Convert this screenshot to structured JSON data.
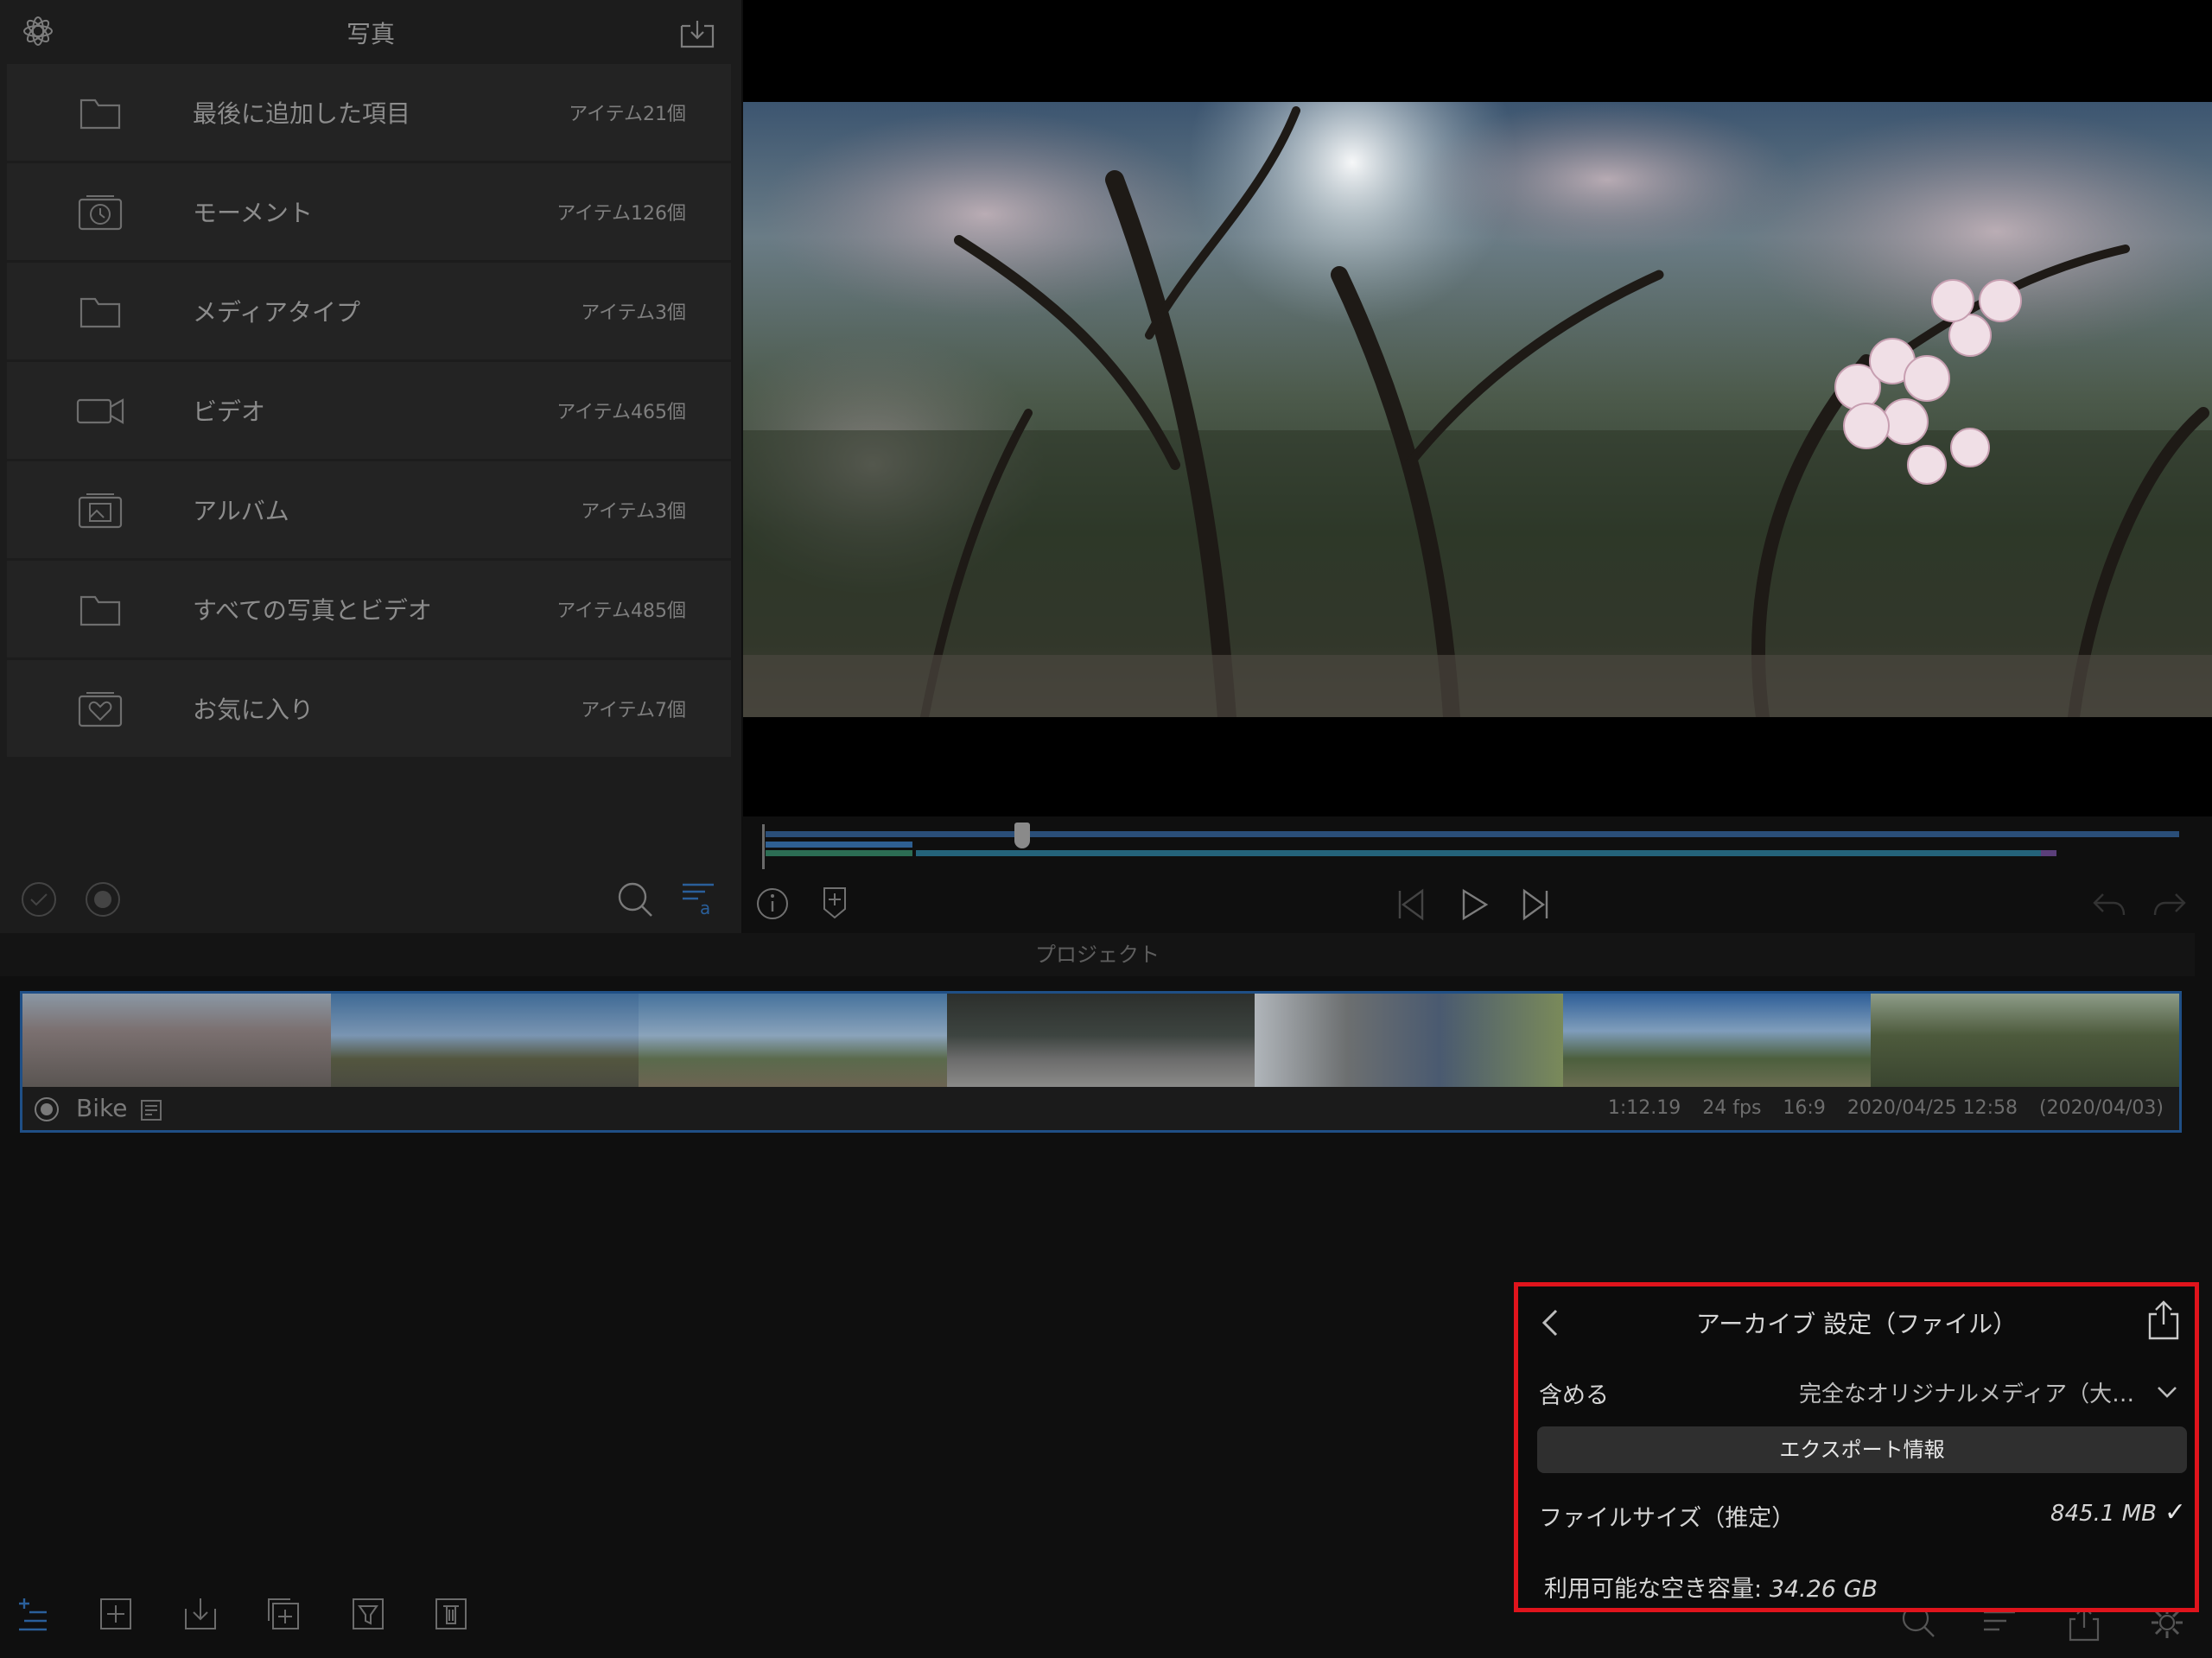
{
  "library": {
    "title": "写真",
    "rows": [
      {
        "label": "最後に追加した項目",
        "count": "アイテム21個",
        "icon": "folder-icon"
      },
      {
        "label": "モーメント",
        "count": "アイテム126個",
        "icon": "moments-icon"
      },
      {
        "label": "メディアタイプ",
        "count": "アイテム3個",
        "icon": "folder-icon"
      },
      {
        "label": "ビデオ",
        "count": "アイテム465個",
        "icon": "video-camera-icon"
      },
      {
        "label": "アルバム",
        "count": "アイテム3個",
        "icon": "album-icon"
      },
      {
        "label": "すべての写真とビデオ",
        "count": "アイテム485個",
        "icon": "folder-icon"
      },
      {
        "label": "お気に入り",
        "count": "アイテム7個",
        "icon": "favorites-icon"
      }
    ]
  },
  "project": {
    "section_label": "プロジェクト",
    "name": "Bike",
    "duration": "1:12.19",
    "fps": "24 fps",
    "aspect": "16:9",
    "modified": "2020/04/25 12:58",
    "created": "(2020/04/03)"
  },
  "archive_popover": {
    "title": "アーカイブ 設定（ファイル）",
    "include_label": "含める",
    "include_value": "完全なオリジナルメディア（大…",
    "export_info_button": "エクスポート情報",
    "file_size_label": "ファイルサイズ（推定）",
    "file_size_value": "845.1 MB",
    "file_size_check": "✓",
    "free_space_label": "利用可能な空き容量: ",
    "free_space_value": "34.26 GB"
  },
  "colors": {
    "accent_blue": "#1f4f86",
    "highlight_red": "#e0141c"
  }
}
